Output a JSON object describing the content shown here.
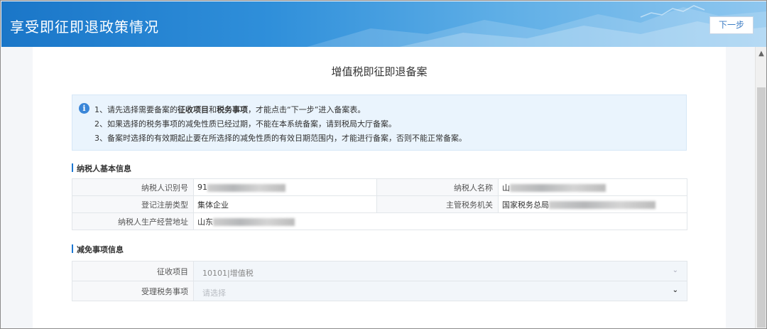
{
  "header": {
    "title": "享受即征即退政策情况",
    "next_label": "下一步"
  },
  "page": {
    "title": "增值税即征即退备案"
  },
  "notice": {
    "line1_prefix": "1、请先选择需要备案的",
    "line1_bold1": "征收项目",
    "line1_mid": "和",
    "line1_bold2": "税务事项",
    "line1_suffix": "，才能点击“下一步”进入备案表。",
    "line2": "2、如果选择的税务事项的减免性质已经过期，不能在本系统备案，请到税局大厅备案。",
    "line3": "3、备案时选择的有效期起止要在所选择的减免性质的有效日期范围内，才能进行备案，否则不能正常备案。"
  },
  "taxpayer_section": {
    "title": "纳税人基本信息",
    "id_label": "纳税人识别号",
    "id_value_visible": "91",
    "name_label": "纳税人名称",
    "name_value_visible": "山",
    "reg_type_label": "登记注册类型",
    "reg_type_value": "集体企业",
    "authority_label": "主管税务机关",
    "authority_value_visible": "国家税务总局",
    "address_label": "纳税人生产经营地址",
    "address_value_visible": "山东"
  },
  "relief_section": {
    "title": "减免事项信息",
    "levy_label": "征收项目",
    "levy_value": "10101|增值税",
    "matter_label": "受理税务事项",
    "matter_placeholder": "请选择"
  }
}
